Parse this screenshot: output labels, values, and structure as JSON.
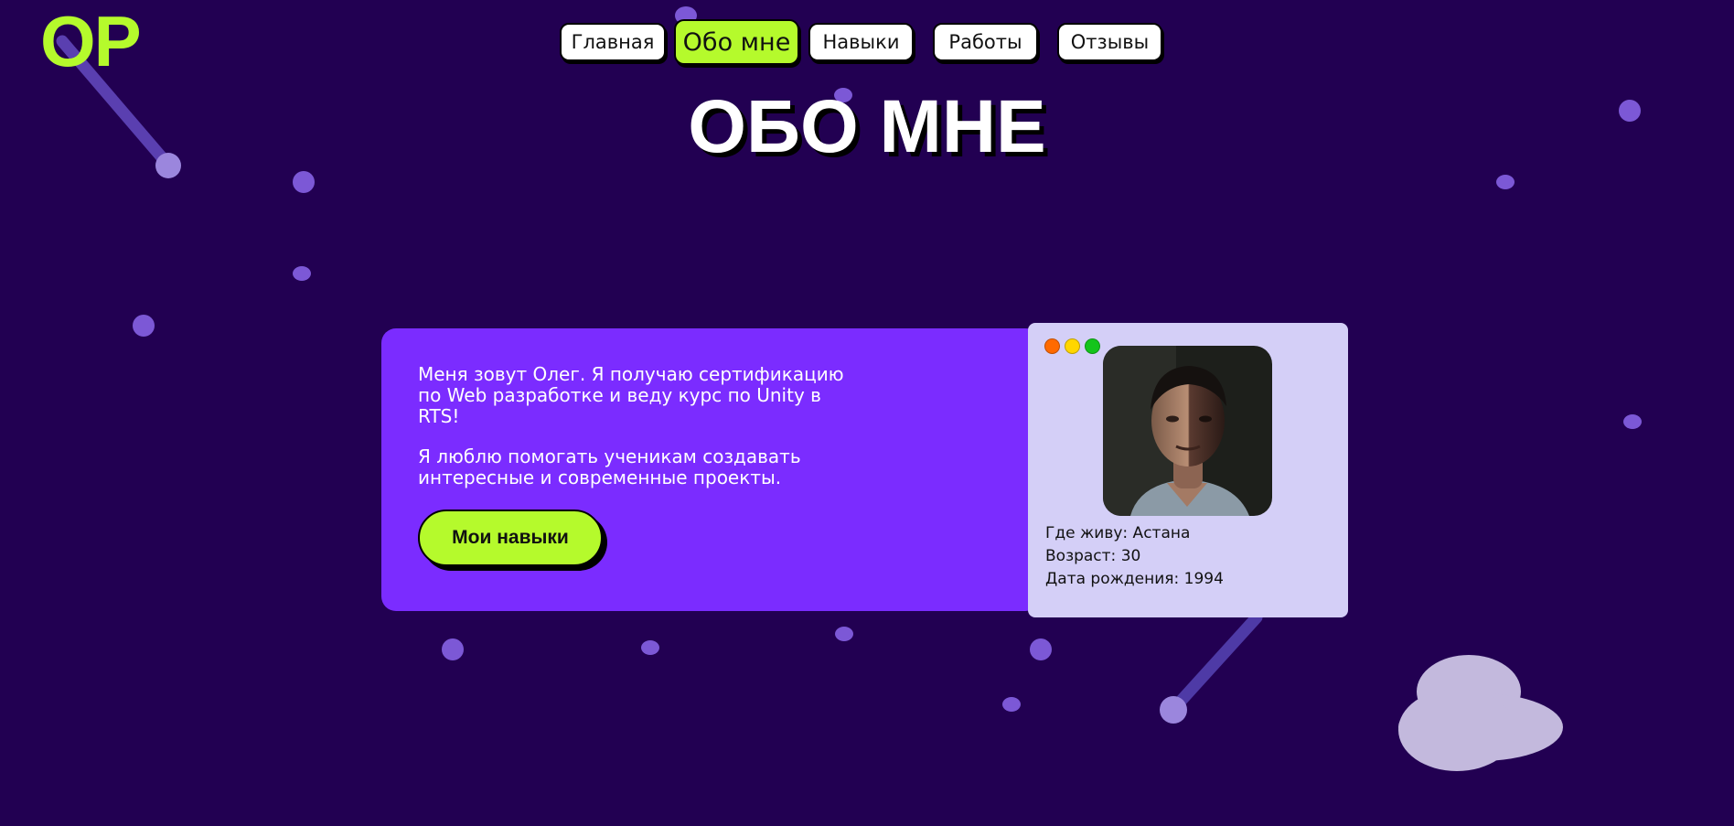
{
  "logo": "OP",
  "nav": {
    "items": [
      {
        "label": "Главная"
      },
      {
        "label": "Обо мне",
        "active": true
      },
      {
        "label": "Навыки"
      },
      {
        "label": "Работы"
      },
      {
        "label": "Отзывы"
      }
    ]
  },
  "page_title": "ОБО МНЕ",
  "about": {
    "paragraph1": "Меня зовут Олег. Я получаю сертификацию по Web разработке и веду курс по Unity в RTS!",
    "paragraph2": "Я люблю помогать ученикам создавать интересные и современные проекты.",
    "button_label": "Мои навыки"
  },
  "profile": {
    "window_dots": [
      "#ff6a00",
      "#ffd600",
      "#14c41b"
    ],
    "city": "Где живу: Астана",
    "age": "Возраст: 30",
    "birth": "Дата рождения: 1994"
  },
  "colors": {
    "background": "#220052",
    "accent": "#b5fa2c",
    "card": "#7b2cff",
    "profile_card": "#d4cff7",
    "decor": "#7c58d6"
  }
}
